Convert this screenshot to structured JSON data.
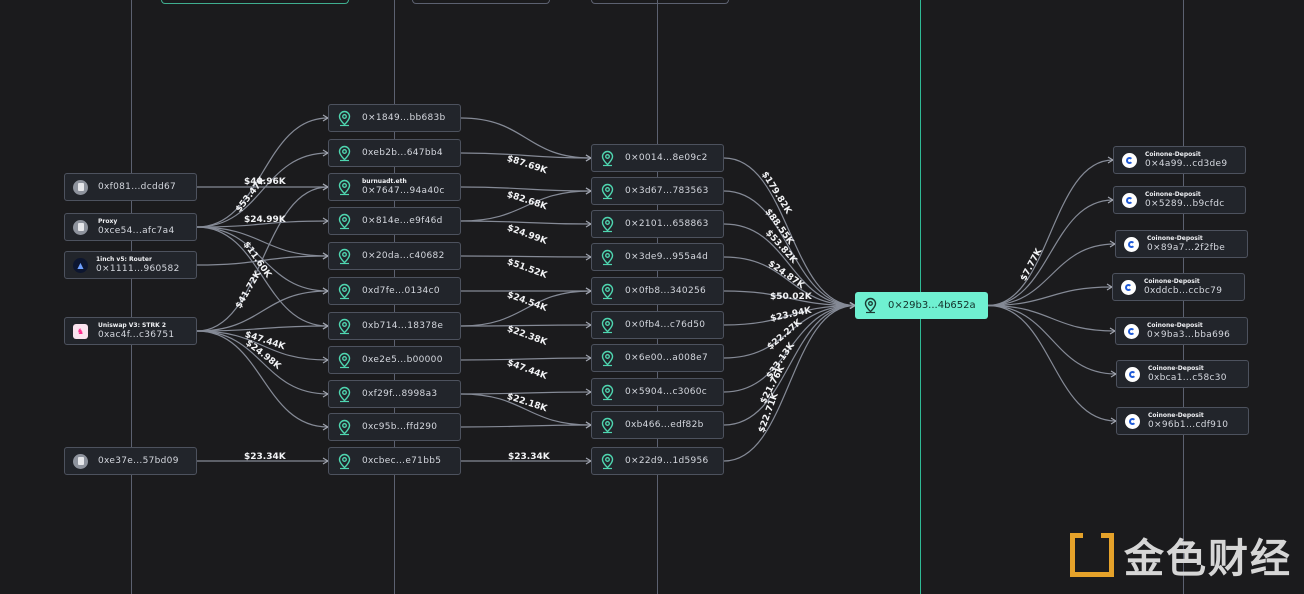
{
  "sources": [
    {
      "id": "s1",
      "label": "",
      "address": "0xf081...dcdd67",
      "icon": "document-icon"
    },
    {
      "id": "s2",
      "label": "Proxy",
      "address": "0xce54...afc7a4",
      "icon": "document-icon"
    },
    {
      "id": "s3",
      "label": "1inch v5: Router",
      "address": "0×1111...960582",
      "icon": "1inch-logo-icon"
    },
    {
      "id": "s4",
      "label": "Uniswap V3: STRK 2",
      "address": "0xac4f...c36751",
      "icon": "uniswap-logo-icon"
    },
    {
      "id": "s5",
      "label": "",
      "address": "0xe37e...57bd09",
      "icon": "document-icon"
    }
  ],
  "hop1": [
    {
      "id": "a1",
      "label": "",
      "address": "0×1849...bb683b"
    },
    {
      "id": "a2",
      "label": "",
      "address": "0xeb2b...647bb4"
    },
    {
      "id": "a3",
      "label": "burnuadt.eth",
      "address": "0×7647...94a40c"
    },
    {
      "id": "a4",
      "label": "",
      "address": "0×814e...e9f46d"
    },
    {
      "id": "a5",
      "label": "",
      "address": "0×20da...c40682"
    },
    {
      "id": "a6",
      "label": "",
      "address": "0xd7fe...0134c0"
    },
    {
      "id": "a7",
      "label": "",
      "address": "0xb714...18378e"
    },
    {
      "id": "a8",
      "label": "",
      "address": "0xe2e5...b00000"
    },
    {
      "id": "a9",
      "label": "",
      "address": "0xf29f...8998a3"
    },
    {
      "id": "a10",
      "label": "",
      "address": "0xc95b...ffd290"
    },
    {
      "id": "a11",
      "label": "",
      "address": "0xcbec...e71bb5"
    }
  ],
  "hop2": [
    {
      "id": "b1",
      "address": "0×0014...8e09c2"
    },
    {
      "id": "b2",
      "address": "0×3d67...783563"
    },
    {
      "id": "b3",
      "address": "0×2101...658863"
    },
    {
      "id": "b4",
      "address": "0×3de9...955a4d"
    },
    {
      "id": "b5",
      "address": "0×0fb8...340256"
    },
    {
      "id": "b6",
      "address": "0×0fb4...c76d50"
    },
    {
      "id": "b7",
      "address": "0×6e00...a008e7"
    },
    {
      "id": "b8",
      "address": "0×5904...c3060c"
    },
    {
      "id": "b9",
      "address": "0xb466...edf82b"
    },
    {
      "id": "b10",
      "address": "0×22d9...1d5956"
    }
  ],
  "target": {
    "address": "0×29b3...4b652a",
    "icon": "location-pin-icon"
  },
  "deposits": [
    {
      "id": "d1",
      "label": "Coinone-Deposit",
      "address": "0×4a99...cd3de9"
    },
    {
      "id": "d2",
      "label": "Coinone-Deposit",
      "address": "0×5289...b9cfdc"
    },
    {
      "id": "d3",
      "label": "Coinone-Deposit",
      "address": "0×89a7...2f2fbe"
    },
    {
      "id": "d4",
      "label": "Coinone-Deposit",
      "address": "0xddcb...ccbc79"
    },
    {
      "id": "d5",
      "label": "Coinone-Deposit",
      "address": "0×9ba3...bba696"
    },
    {
      "id": "d6",
      "label": "Coinone-Deposit",
      "address": "0xbca1...c58c30"
    },
    {
      "id": "d7",
      "label": "Coinone-Deposit",
      "address": "0×96b1...cdf910"
    }
  ],
  "edge_labels_src_hop1": [
    "$40.96K",
    "$53.47K",
    "$24.99K",
    "$11.60K",
    "$41.72K",
    "$47.44K",
    "$24.98K",
    "$23.34K"
  ],
  "edge_labels_hop1_hop2": [
    "$87.69K",
    "$82.68K",
    "$24.99K",
    "$51.52K",
    "$24.54K",
    "$22.38K",
    "$47.44K",
    "$22.18K",
    "$23.34K"
  ],
  "edge_labels_hop2_target": [
    "$179.82K",
    "$88.55K",
    "$53.82K",
    "$24.87K",
    "$50.02K",
    "$23.94K",
    "$22.27K",
    "$33.13K",
    "$21.76K",
    "$22.71K"
  ],
  "edge_label_target_deposits": "$7.77K",
  "watermark": {
    "text": "金色财经"
  },
  "colors": {
    "accent": "#6ff0d1",
    "edge": "#8a8f9c",
    "background": "#1b1b1d"
  }
}
